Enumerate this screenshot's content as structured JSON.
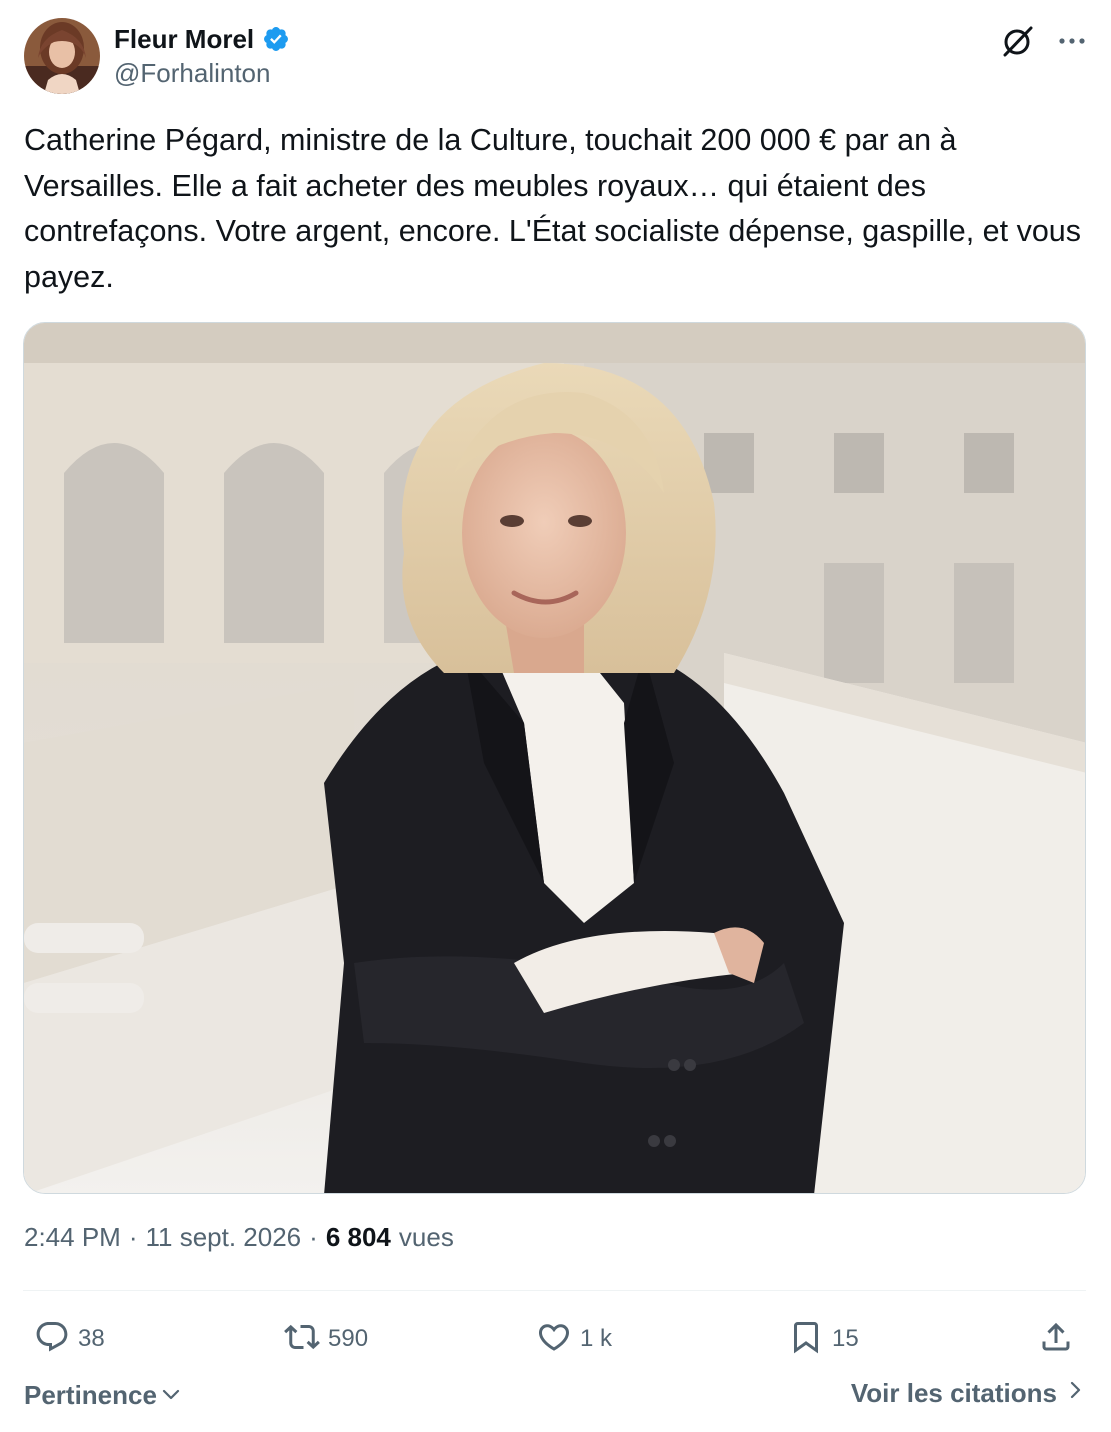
{
  "author": {
    "display_name": "Fleur Morel",
    "handle": "@Forhalinton",
    "verified": true,
    "verified_color": "#1d9bf0"
  },
  "header_icons": [
    "grok-icon",
    "more-icon"
  ],
  "tweet": {
    "text": "Catherine Pégard, ministre de la Culture, touchait 200 000 € par an à Versailles. Elle a fait acheter des meubles royaux… qui étaient des contrefaçons. Votre argent, encore. L'État socialiste dépense, gaspille, et vous payez.",
    "media_alt": "photo"
  },
  "meta": {
    "time": "2:44 PM",
    "separator": "·",
    "date": "11 sept. 2026",
    "views_count": "6 804",
    "views_label": "vues"
  },
  "actions": {
    "replies": {
      "icon": "reply-icon",
      "count": "38"
    },
    "reposts": {
      "icon": "repost-icon",
      "count": "590"
    },
    "likes": {
      "icon": "heart-icon",
      "count": "1 k"
    },
    "bookmarks": {
      "icon": "bookmark-icon",
      "count": "15"
    },
    "share": {
      "icon": "share-icon"
    }
  },
  "footer": {
    "sort_label": "Pertinence",
    "quotes_label": "Voir les citations"
  },
  "colors": {
    "text_primary": "#0f1419",
    "text_secondary": "#536471",
    "divider": "#eff3f4",
    "accent": "#1d9bf0"
  }
}
